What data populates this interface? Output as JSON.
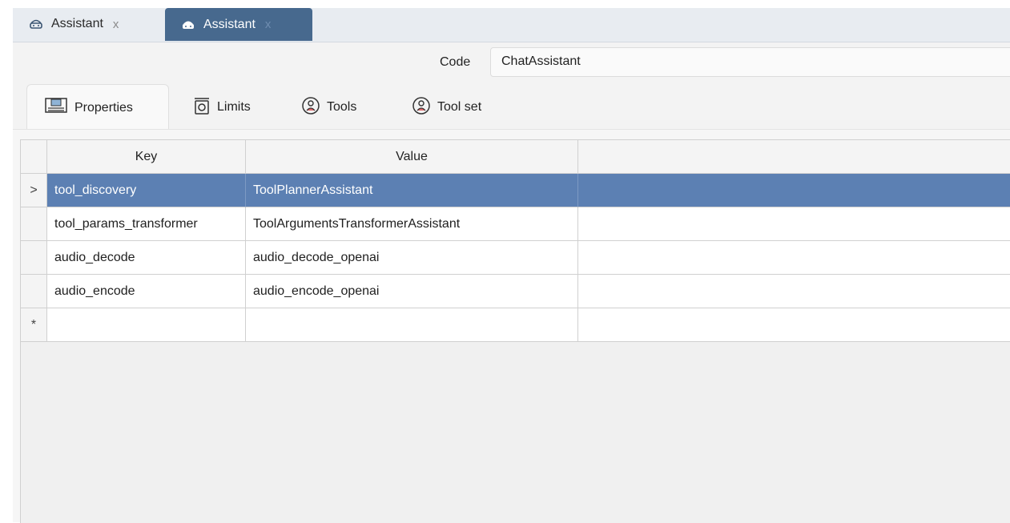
{
  "tabs": [
    {
      "label": "Assistant",
      "close": "x",
      "icon": "assistant-icon",
      "active": false
    },
    {
      "label": "Assistant",
      "close": "x",
      "icon": "assistant-filled-icon",
      "active": true
    }
  ],
  "form": {
    "code_label": "Code",
    "code_value": "ChatAssistant"
  },
  "subtabs": [
    {
      "label": "Properties",
      "icon": "properties-icon"
    },
    {
      "label": "Limits",
      "icon": "limits-icon"
    },
    {
      "label": "Tools",
      "icon": "tools-icon"
    },
    {
      "label": "Tool set",
      "icon": "toolset-icon"
    }
  ],
  "grid": {
    "columns": [
      "Key",
      "Value"
    ],
    "current_row_marker": ">",
    "new_row_marker": "*",
    "rows": [
      {
        "key": "tool_discovery",
        "value": "ToolPlannerAssistant"
      },
      {
        "key": "tool_params_transformer",
        "value": "ToolArgumentsTransformerAssistant"
      },
      {
        "key": "audio_decode",
        "value": "audio_decode_openai"
      },
      {
        "key": "audio_encode",
        "value": "audio_encode_openai"
      }
    ]
  },
  "colors": {
    "accent": "#47698e",
    "selection": "#5c80b3"
  }
}
